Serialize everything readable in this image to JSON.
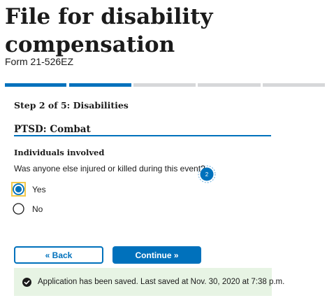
{
  "header": {
    "title_line1": "File for disability",
    "title_line2": "compensation",
    "form_number": "Form 21-526EZ"
  },
  "progress": {
    "total_segments": 5,
    "completed_segments": 2,
    "colors": {
      "complete": "#0071bc",
      "incomplete": "#d6d7d9"
    }
  },
  "step": {
    "label": "Step 2 of 5: Disabilities"
  },
  "section": {
    "title": "PTSD: Combat"
  },
  "question_group": {
    "heading": "Individuals involved",
    "question": "Was anyone else injured or killed during this event?",
    "options": [
      {
        "label": "Yes",
        "selected": true
      },
      {
        "label": "No",
        "selected": false
      }
    ]
  },
  "marker": {
    "number": "2"
  },
  "buttons": {
    "back_label": "« Back",
    "continue_label": "Continue »"
  },
  "alert": {
    "icon": "check-circle-icon",
    "text": "Application has been saved. Last saved at Nov. 30, 2020 at 7:38 p.m.",
    "background": "#e7f4e4"
  }
}
